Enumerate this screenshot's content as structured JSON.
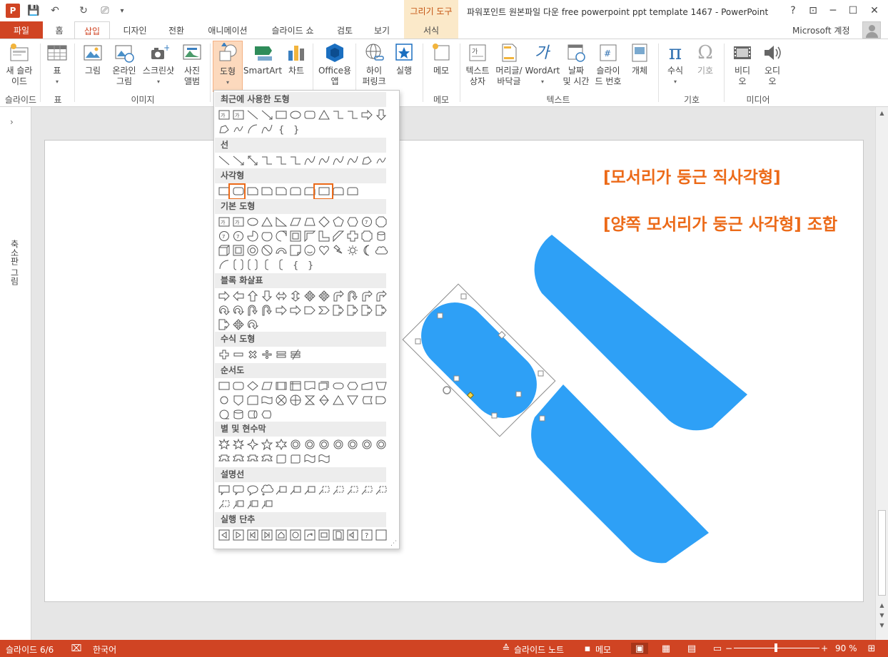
{
  "titlebar": {
    "app_logo": "P",
    "title": "파워포인트 원본파일 다운 free powerpoint ppt template 1467 - PowerPoint",
    "contextual_group": "그리기 도구",
    "help": "?",
    "ribbon_display": "⊡",
    "minimize": "─",
    "restore": "☐",
    "close": "✕"
  },
  "quick_access": {
    "save": "💾",
    "undo": "↶",
    "redo": "↻",
    "slideshow": "⎚",
    "customize": "▾"
  },
  "tabs": {
    "file": "파일",
    "items": [
      "홈",
      "삽입",
      "디자인",
      "전환",
      "애니메이션",
      "슬라이드 쇼",
      "검토",
      "보기"
    ],
    "active": "삽입",
    "format": "서식",
    "account": "Microsoft 계정"
  },
  "ribbon": {
    "new_slide": "새 슬라\n이드",
    "table": "표",
    "picture": "그림",
    "online_picture": "온라인\n그림",
    "screenshot": "스크린샷",
    "photo_album": "사진\n앨범",
    "shapes": "도형",
    "smartart": "SmartArt",
    "chart": "차트",
    "office_apps": "Office용\n앱",
    "hyperlink": "하이\n퍼링크",
    "action": "실행",
    "comment": "메모",
    "textbox": "텍스트\n상자",
    "header_footer": "머리글/\n바닥글",
    "wordart": "WordArt",
    "date_time": "날짜\n및 시간",
    "slide_number": "슬라이\n드 번호",
    "object": "개체",
    "equation": "수식",
    "symbol": "기호",
    "video": "비디\n오",
    "audio": "오디\n오",
    "groups": {
      "slides": "슬라이드",
      "tables": "표",
      "images": "이미지",
      "comments": "메모",
      "text": "텍스트",
      "symbols": "기호",
      "media": "미디어"
    }
  },
  "shapes_menu": {
    "sections": [
      "최근에 사용한 도형",
      "선",
      "사각형",
      "기본 도형",
      "블록 화살표",
      "수식 도형",
      "순서도",
      "별 및 현수막",
      "설명선",
      "실행 단추"
    ],
    "grip": "⋰"
  },
  "thumbnail_pane": {
    "expand": "›",
    "label": "축소판 그림"
  },
  "slide": {
    "note1": "[모서리가 둥근 직사각형]",
    "note2": "[양쪽 모서리가 둥근 사각형] 조합",
    "shape_color": "#2ea0f6"
  },
  "statusbar": {
    "slide_info": "슬라이드 6/6",
    "language": "한국어",
    "notes": "슬라이드 노트",
    "comments": "메모",
    "zoom": "90 %",
    "zoom_minus": "−",
    "zoom_plus": "+"
  },
  "colors": {
    "accent": "#d04423",
    "highlight_orange": "#ec6a18",
    "contextual_bg": "#fbe9c9"
  }
}
